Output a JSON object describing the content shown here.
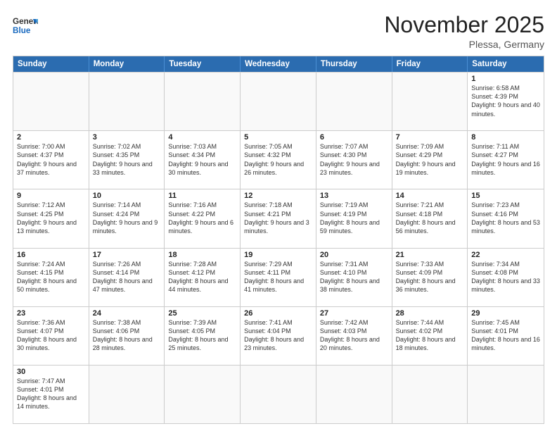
{
  "header": {
    "logo_general": "General",
    "logo_blue": "Blue",
    "month_title": "November 2025",
    "location": "Plessa, Germany"
  },
  "days": [
    "Sunday",
    "Monday",
    "Tuesday",
    "Wednesday",
    "Thursday",
    "Friday",
    "Saturday"
  ],
  "weeks": [
    [
      {
        "num": "",
        "text": ""
      },
      {
        "num": "",
        "text": ""
      },
      {
        "num": "",
        "text": ""
      },
      {
        "num": "",
        "text": ""
      },
      {
        "num": "",
        "text": ""
      },
      {
        "num": "",
        "text": ""
      },
      {
        "num": "1",
        "text": "Sunrise: 6:58 AM\nSunset: 4:39 PM\nDaylight: 9 hours and 40 minutes."
      }
    ],
    [
      {
        "num": "2",
        "text": "Sunrise: 7:00 AM\nSunset: 4:37 PM\nDaylight: 9 hours and 37 minutes."
      },
      {
        "num": "3",
        "text": "Sunrise: 7:02 AM\nSunset: 4:35 PM\nDaylight: 9 hours and 33 minutes."
      },
      {
        "num": "4",
        "text": "Sunrise: 7:03 AM\nSunset: 4:34 PM\nDaylight: 9 hours and 30 minutes."
      },
      {
        "num": "5",
        "text": "Sunrise: 7:05 AM\nSunset: 4:32 PM\nDaylight: 9 hours and 26 minutes."
      },
      {
        "num": "6",
        "text": "Sunrise: 7:07 AM\nSunset: 4:30 PM\nDaylight: 9 hours and 23 minutes."
      },
      {
        "num": "7",
        "text": "Sunrise: 7:09 AM\nSunset: 4:29 PM\nDaylight: 9 hours and 19 minutes."
      },
      {
        "num": "8",
        "text": "Sunrise: 7:11 AM\nSunset: 4:27 PM\nDaylight: 9 hours and 16 minutes."
      }
    ],
    [
      {
        "num": "9",
        "text": "Sunrise: 7:12 AM\nSunset: 4:25 PM\nDaylight: 9 hours and 13 minutes."
      },
      {
        "num": "10",
        "text": "Sunrise: 7:14 AM\nSunset: 4:24 PM\nDaylight: 9 hours and 9 minutes."
      },
      {
        "num": "11",
        "text": "Sunrise: 7:16 AM\nSunset: 4:22 PM\nDaylight: 9 hours and 6 minutes."
      },
      {
        "num": "12",
        "text": "Sunrise: 7:18 AM\nSunset: 4:21 PM\nDaylight: 9 hours and 3 minutes."
      },
      {
        "num": "13",
        "text": "Sunrise: 7:19 AM\nSunset: 4:19 PM\nDaylight: 8 hours and 59 minutes."
      },
      {
        "num": "14",
        "text": "Sunrise: 7:21 AM\nSunset: 4:18 PM\nDaylight: 8 hours and 56 minutes."
      },
      {
        "num": "15",
        "text": "Sunrise: 7:23 AM\nSunset: 4:16 PM\nDaylight: 8 hours and 53 minutes."
      }
    ],
    [
      {
        "num": "16",
        "text": "Sunrise: 7:24 AM\nSunset: 4:15 PM\nDaylight: 8 hours and 50 minutes."
      },
      {
        "num": "17",
        "text": "Sunrise: 7:26 AM\nSunset: 4:14 PM\nDaylight: 8 hours and 47 minutes."
      },
      {
        "num": "18",
        "text": "Sunrise: 7:28 AM\nSunset: 4:12 PM\nDaylight: 8 hours and 44 minutes."
      },
      {
        "num": "19",
        "text": "Sunrise: 7:29 AM\nSunset: 4:11 PM\nDaylight: 8 hours and 41 minutes."
      },
      {
        "num": "20",
        "text": "Sunrise: 7:31 AM\nSunset: 4:10 PM\nDaylight: 8 hours and 38 minutes."
      },
      {
        "num": "21",
        "text": "Sunrise: 7:33 AM\nSunset: 4:09 PM\nDaylight: 8 hours and 36 minutes."
      },
      {
        "num": "22",
        "text": "Sunrise: 7:34 AM\nSunset: 4:08 PM\nDaylight: 8 hours and 33 minutes."
      }
    ],
    [
      {
        "num": "23",
        "text": "Sunrise: 7:36 AM\nSunset: 4:07 PM\nDaylight: 8 hours and 30 minutes."
      },
      {
        "num": "24",
        "text": "Sunrise: 7:38 AM\nSunset: 4:06 PM\nDaylight: 8 hours and 28 minutes."
      },
      {
        "num": "25",
        "text": "Sunrise: 7:39 AM\nSunset: 4:05 PM\nDaylight: 8 hours and 25 minutes."
      },
      {
        "num": "26",
        "text": "Sunrise: 7:41 AM\nSunset: 4:04 PM\nDaylight: 8 hours and 23 minutes."
      },
      {
        "num": "27",
        "text": "Sunrise: 7:42 AM\nSunset: 4:03 PM\nDaylight: 8 hours and 20 minutes."
      },
      {
        "num": "28",
        "text": "Sunrise: 7:44 AM\nSunset: 4:02 PM\nDaylight: 8 hours and 18 minutes."
      },
      {
        "num": "29",
        "text": "Sunrise: 7:45 AM\nSunset: 4:01 PM\nDaylight: 8 hours and 16 minutes."
      }
    ],
    [
      {
        "num": "30",
        "text": "Sunrise: 7:47 AM\nSunset: 4:01 PM\nDaylight: 8 hours and 14 minutes."
      },
      {
        "num": "",
        "text": ""
      },
      {
        "num": "",
        "text": ""
      },
      {
        "num": "",
        "text": ""
      },
      {
        "num": "",
        "text": ""
      },
      {
        "num": "",
        "text": ""
      },
      {
        "num": "",
        "text": ""
      }
    ]
  ]
}
